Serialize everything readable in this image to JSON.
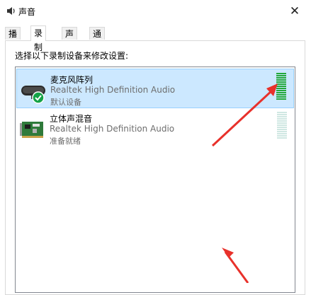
{
  "window": {
    "title": "声音"
  },
  "tabs": [
    {
      "label": "播放"
    },
    {
      "label": "录制"
    },
    {
      "label": "声音"
    },
    {
      "label": "通信"
    }
  ],
  "instruction": "选择以下录制设备来修改设置:",
  "devices": [
    {
      "name": "麦克风阵列",
      "driver": "Realtek High Definition Audio",
      "status": "默认设备",
      "selected": true,
      "level_fraction": 1.0
    },
    {
      "name": "立体声混音",
      "driver": "Realtek High Definition Audio",
      "status": "准备就绪",
      "selected": false,
      "level_fraction": 0.0
    }
  ],
  "colors": {
    "selection_bg": "#cce8ff",
    "level_active": "#22a83a",
    "level_idle": "#cfe7e2",
    "arrow": "#e8312b",
    "check": "#14a247"
  }
}
